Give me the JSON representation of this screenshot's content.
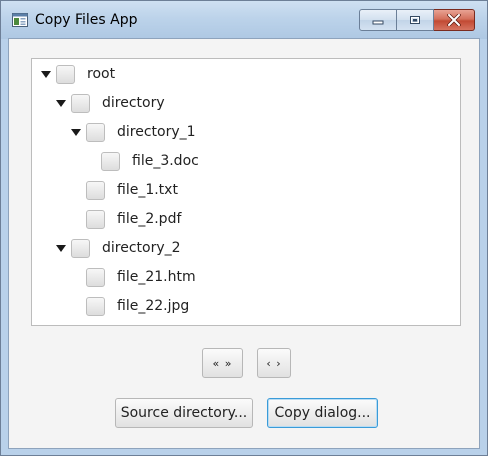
{
  "window": {
    "title": "Copy Files App"
  },
  "icons": {
    "app": "app-window-icon",
    "minimize": "minimize-icon",
    "maximize": "maximize-icon",
    "close": "close-icon",
    "expand": "expand-arrow-icon"
  },
  "tree": {
    "nodes": [
      {
        "label": "root",
        "expanded": true,
        "checked": false
      },
      {
        "label": "directory",
        "expanded": true,
        "checked": false
      },
      {
        "label": "directory_1",
        "expanded": true,
        "checked": false
      },
      {
        "label": "file_3.doc",
        "checked": false
      },
      {
        "label": "file_1.txt",
        "checked": false
      },
      {
        "label": "file_2.pdf",
        "checked": false
      },
      {
        "label": "directory_2",
        "expanded": true,
        "checked": false
      },
      {
        "label": "file_21.htm",
        "checked": false
      },
      {
        "label": "file_22.jpg",
        "checked": false
      }
    ]
  },
  "buttons": {
    "expand_collapse_all": "« »",
    "expand_collapse": "‹ ›",
    "source_directory": "Source directory...",
    "copy_dialog": "Copy dialog..."
  },
  "colors": {
    "title_bar": "#bcd3ea",
    "client_bg": "#f4f4f4",
    "close_button": "#c24a33",
    "default_button_border": "#3a9bd8"
  }
}
